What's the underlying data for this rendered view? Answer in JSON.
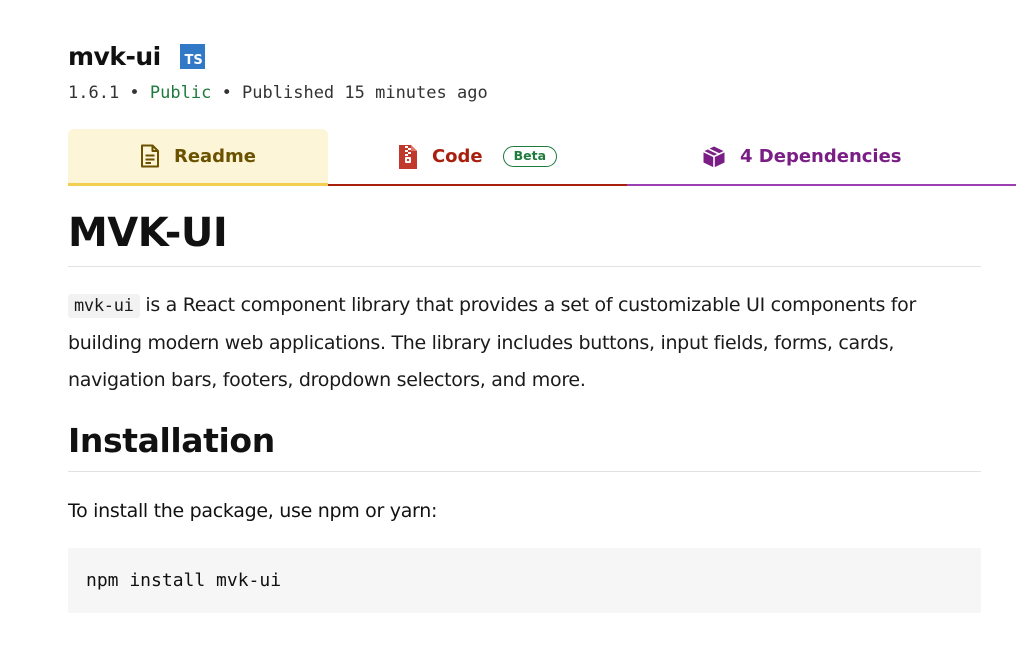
{
  "package": {
    "name": "mvk-ui",
    "ts_badge": "TS",
    "version": "1.6.1",
    "separator": " • ",
    "visibility": "Public",
    "published": "Published 15 minutes ago"
  },
  "tabs": [
    {
      "label": "Readme",
      "icon": "document-icon"
    },
    {
      "label": "Code",
      "icon": "zip-file-icon",
      "badge": "Beta"
    },
    {
      "label": "4 Dependencies",
      "icon": "box-icon"
    }
  ],
  "readme": {
    "title": "MVK-UI",
    "intro_code": "mvk-ui",
    "intro_text": " is a React component library that provides a set of customizable UI components for building modern web applications. The library includes buttons, input fields, forms, cards, navigation bars, footers, dropdown selectors, and more.",
    "installation_heading": "Installation",
    "installation_text": "To install the package, use npm or yarn:",
    "install_command": "npm install mvk-ui"
  },
  "colors": {
    "readme_tab_bg": "#fdf5d8",
    "readme_tab_accent": "#f2cf52",
    "code_tab": "#a8200d",
    "deps_tab": "#7a1e86",
    "public": "#1f7a3d",
    "ts_badge": "#3178c6"
  }
}
